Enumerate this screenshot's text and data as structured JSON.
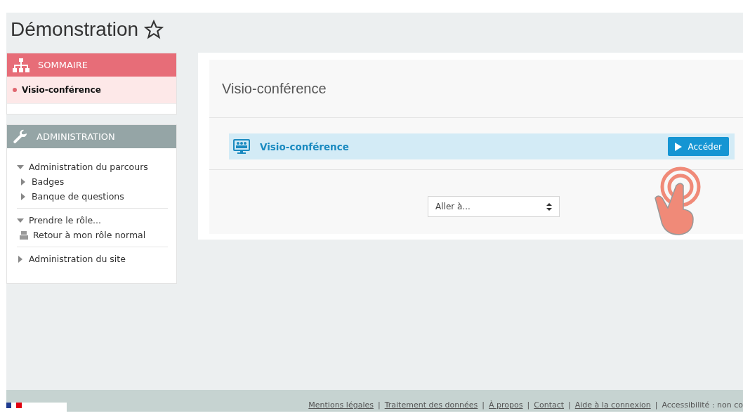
{
  "page_title": "Démonstration",
  "favourite": {
    "starred": false
  },
  "summary_block": {
    "title": "SOMMAIRE",
    "items": [
      {
        "label": "Visio-conférence",
        "selected": true
      }
    ]
  },
  "admin_block": {
    "title": "ADMINISTRATION",
    "groups": [
      {
        "items": [
          {
            "label": "Administration du parcours",
            "kind": "branch",
            "expanded": true,
            "children": [
              {
                "label": "Badges",
                "kind": "branch",
                "expanded": false
              },
              {
                "label": "Banque de questions",
                "kind": "branch",
                "expanded": false
              }
            ]
          }
        ]
      },
      {
        "items": [
          {
            "label": "Prendre le rôle...",
            "kind": "branch",
            "expanded": true,
            "children": [
              {
                "label": "Retour à mon rôle normal",
                "kind": "leaf"
              }
            ]
          }
        ]
      },
      {
        "items": [
          {
            "label": "Administration du site",
            "kind": "branch",
            "expanded": false
          }
        ]
      }
    ]
  },
  "content": {
    "section_title": "Visio-conférence",
    "activity": {
      "name": "Visio-conférence",
      "button": "Accéder"
    },
    "jump": {
      "placeholder": "Aller à..."
    }
  },
  "footer": {
    "links": [
      "Mentions légales",
      "Traitement des données",
      "À propos",
      "Contact",
      "Aide à la connexion"
    ],
    "separator": "|",
    "tail": "Accessibilité : non co"
  }
}
